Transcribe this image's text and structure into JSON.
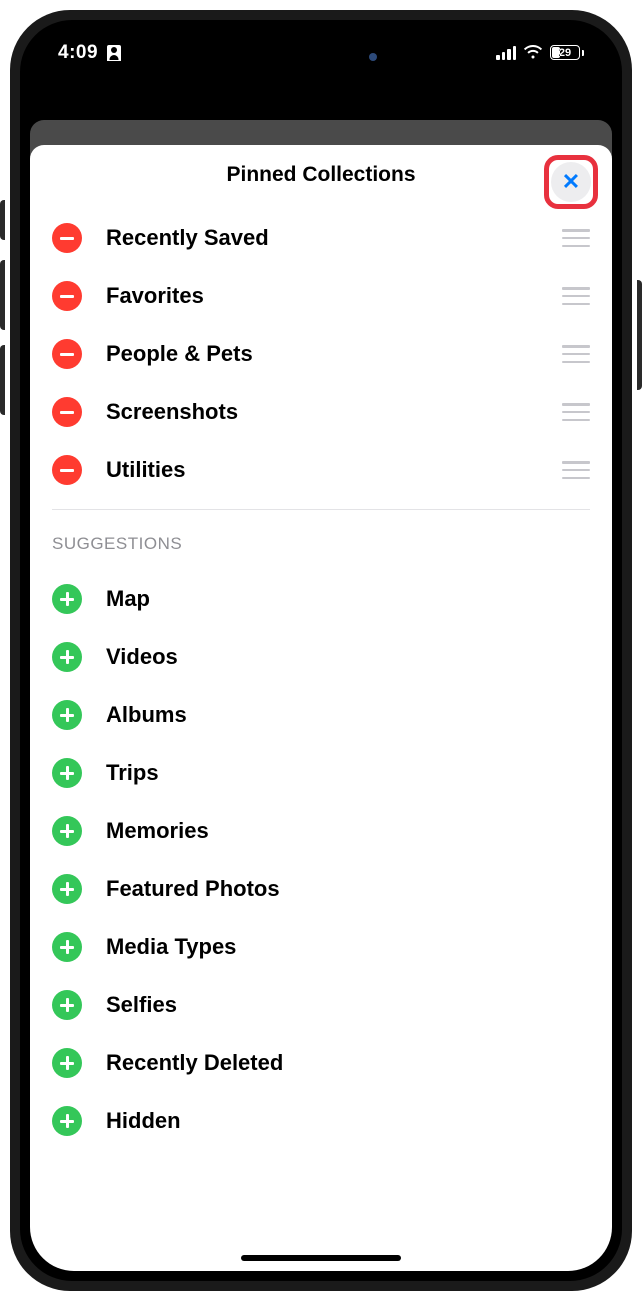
{
  "status": {
    "time": "4:09",
    "battery_pct": "29"
  },
  "sheet": {
    "title": "Pinned Collections",
    "suggestions_header": "SUGGESTIONS",
    "pinned": [
      {
        "label": "Recently Saved"
      },
      {
        "label": "Favorites"
      },
      {
        "label": "People & Pets"
      },
      {
        "label": "Screenshots"
      },
      {
        "label": "Utilities"
      }
    ],
    "suggestions": [
      {
        "label": "Map"
      },
      {
        "label": "Videos"
      },
      {
        "label": "Albums"
      },
      {
        "label": "Trips"
      },
      {
        "label": "Memories"
      },
      {
        "label": "Featured Photos"
      },
      {
        "label": "Media Types"
      },
      {
        "label": "Selfies"
      },
      {
        "label": "Recently Deleted"
      },
      {
        "label": "Hidden"
      }
    ]
  }
}
